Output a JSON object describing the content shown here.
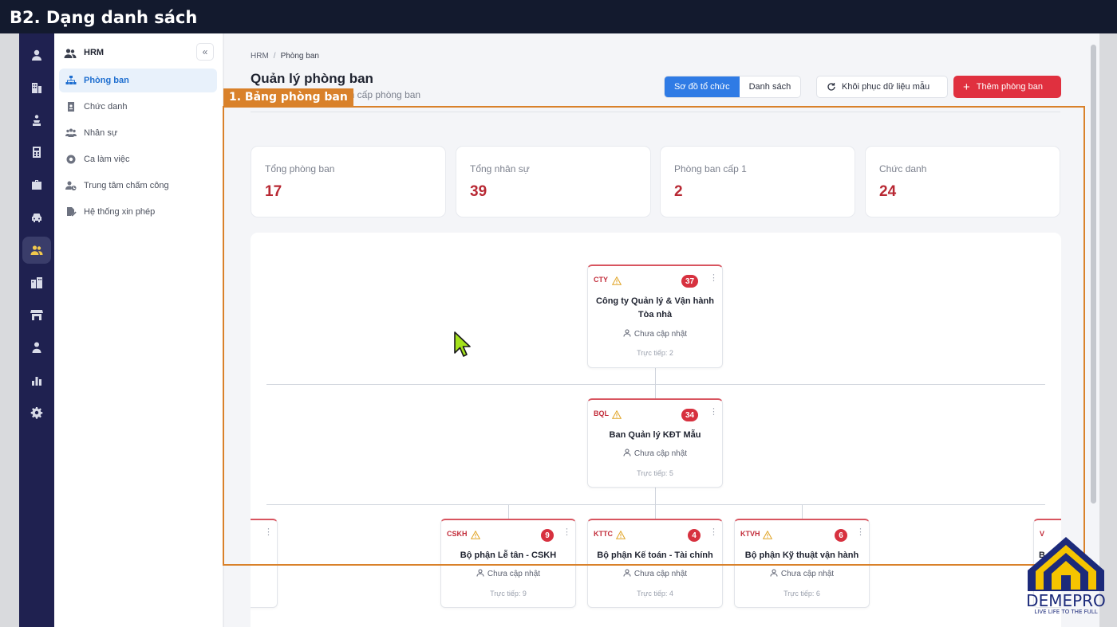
{
  "banner": {
    "title": "B2. Dạng danh sách"
  },
  "rail": {
    "icons": [
      "user-icon",
      "building-icon",
      "people-carry-icon",
      "calculator-icon",
      "briefcase-icon",
      "car-icon",
      "users-icon",
      "city-icon",
      "store-icon",
      "person-icon",
      "chart-icon",
      "gear-icon"
    ],
    "active_icon": "users-icon",
    "active_color": "#f2c94c"
  },
  "sidebar": {
    "header": "HRM",
    "collapse_glyph": "«",
    "items": [
      {
        "label": "Phòng ban",
        "icon": "sitemap-icon",
        "active": true
      },
      {
        "label": "Chức danh",
        "icon": "id-badge-icon"
      },
      {
        "label": "Nhân sự",
        "icon": "users-icon"
      },
      {
        "label": "Ca làm việc",
        "icon": "clock-icon"
      },
      {
        "label": "Trung tâm chấm công",
        "icon": "user-clock-icon"
      },
      {
        "label": "Hệ thống xin phép",
        "icon": "file-signature-icon"
      }
    ]
  },
  "breadcrumb": {
    "root": "HRM",
    "sep": "/",
    "current": "Phòng ban"
  },
  "page": {
    "title": "Quản lý phòng ban",
    "subtitle": "ân cấp phòng ban"
  },
  "toolbar": {
    "view_org": "Sơ đồ tổ chức",
    "view_list": "Danh sách",
    "reset": "Khôi phục dữ liệu mẫu",
    "add": "Thêm phòng ban",
    "accent": "#2f7be5",
    "danger": "#e0303f"
  },
  "stats": [
    {
      "label": "Tổng phòng ban",
      "value": "17"
    },
    {
      "label": "Tổng nhân sự",
      "value": "39"
    },
    {
      "label": "Phòng ban cấp 1",
      "value": "2"
    },
    {
      "label": "Chức danh",
      "value": "24"
    }
  ],
  "org": {
    "nodes": [
      {
        "code": "CTY",
        "count": "37",
        "name": "Công ty Quản lý & Vận hành Tòa nhà",
        "manager": "Chưa cập nhật",
        "direct": "Trực tiếp: 2"
      },
      {
        "code": "BQL",
        "count": "34",
        "name": "Ban Quản lý KĐT Mẫu",
        "manager": "Chưa cập nhật",
        "direct": "Trực tiếp: 5"
      },
      {
        "code": "CSKH",
        "count": "9",
        "name": "Bộ phận Lễ tân - CSKH",
        "manager": "Chưa cập nhật",
        "direct": "Trực tiếp: 9"
      },
      {
        "code": "KTTC",
        "count": "4",
        "name": "Bộ phận Kế toán - Tài chính",
        "manager": "Chưa cập nhật",
        "direct": "Trực tiếp: 4"
      },
      {
        "code": "KTVH",
        "count": "6",
        "name": "Bộ phận Kỹ thuật vận hành",
        "manager": "Chưa cập nhật",
        "direct": "Trực tiếp: 6"
      },
      {
        "code": "V",
        "name": "B"
      }
    ]
  },
  "annotation": {
    "label": "1. Bảng phòng ban",
    "color": "#d9812a"
  },
  "logo": {
    "name": "DEMEPRO",
    "tagline": "LIVE LIFE TO THE FULL",
    "color": "#1c2a7a",
    "accent": "#f5c400"
  }
}
